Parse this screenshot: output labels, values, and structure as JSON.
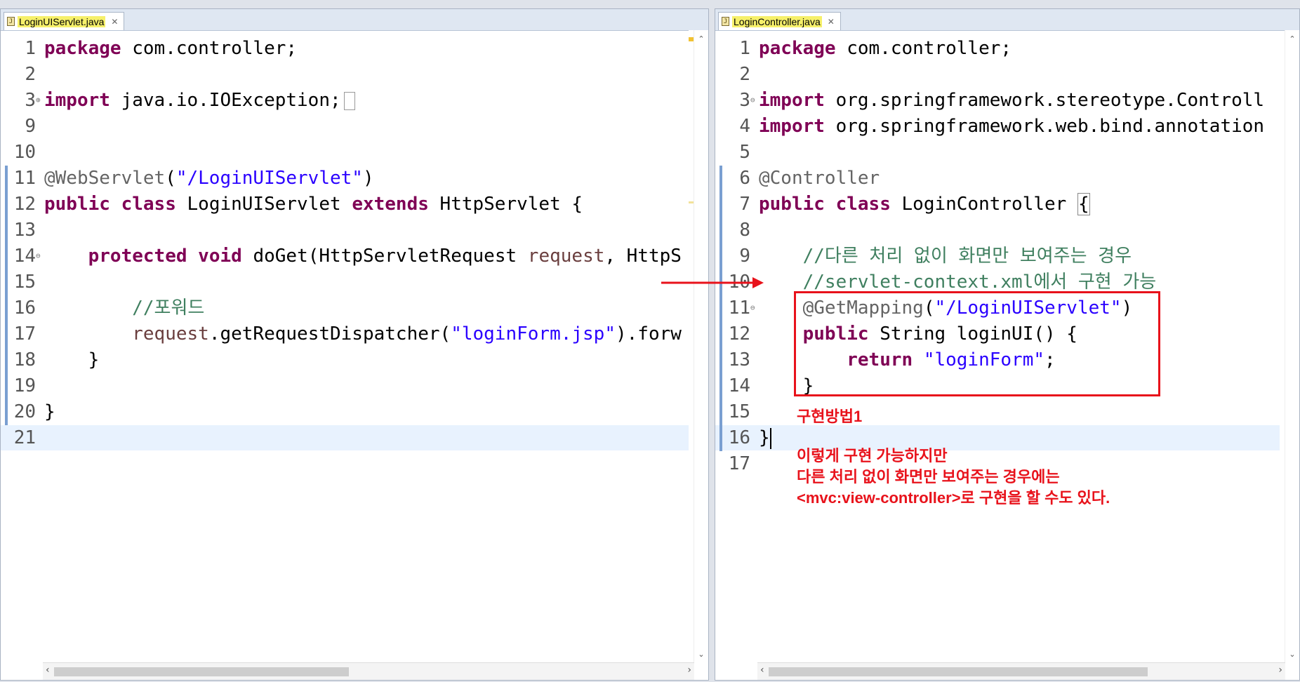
{
  "left_editor": {
    "tab_label": "LoginUIServlet.java",
    "lines": [
      {
        "n": "1",
        "segs": [
          {
            "t": "package",
            "c": "kw"
          },
          {
            "t": " com.controller;",
            "c": ""
          }
        ]
      },
      {
        "n": "2",
        "segs": []
      },
      {
        "n": "3",
        "segs": [
          {
            "t": "import",
            "c": "kw"
          },
          {
            "t": " java.io.IOException;",
            "c": ""
          }
        ],
        "fold": "⊕",
        "collapsed": true
      },
      {
        "n": "9",
        "segs": []
      },
      {
        "n": "10",
        "segs": []
      },
      {
        "n": "11",
        "segs": [
          {
            "t": "@WebServlet",
            "c": "ann"
          },
          {
            "t": "(",
            "c": ""
          },
          {
            "t": "\"/LoginUIServlet\"",
            "c": "str"
          },
          {
            "t": ")",
            "c": ""
          }
        ]
      },
      {
        "n": "12",
        "segs": [
          {
            "t": "public",
            "c": "kw"
          },
          {
            "t": " ",
            "c": ""
          },
          {
            "t": "class",
            "c": "kw"
          },
          {
            "t": " LoginUIServlet ",
            "c": ""
          },
          {
            "t": "extends",
            "c": "kw"
          },
          {
            "t": " HttpServlet {",
            "c": ""
          }
        ]
      },
      {
        "n": "13",
        "segs": []
      },
      {
        "n": "14",
        "segs": [
          {
            "t": "    ",
            "c": ""
          },
          {
            "t": "protected",
            "c": "kw"
          },
          {
            "t": " ",
            "c": ""
          },
          {
            "t": "void",
            "c": "kw"
          },
          {
            "t": " doGet(HttpServletRequest ",
            "c": ""
          },
          {
            "t": "request",
            "c": "param"
          },
          {
            "t": ", HttpS",
            "c": ""
          }
        ],
        "fold": "⊖"
      },
      {
        "n": "15",
        "segs": []
      },
      {
        "n": "16",
        "segs": [
          {
            "t": "        ",
            "c": ""
          },
          {
            "t": "//포워드",
            "c": "cmt"
          }
        ]
      },
      {
        "n": "17",
        "segs": [
          {
            "t": "        ",
            "c": ""
          },
          {
            "t": "request",
            "c": "param"
          },
          {
            "t": ".getRequestDispatcher(",
            "c": ""
          },
          {
            "t": "\"loginForm.jsp\"",
            "c": "str"
          },
          {
            "t": ").forw",
            "c": ""
          }
        ]
      },
      {
        "n": "18",
        "segs": [
          {
            "t": "    }",
            "c": ""
          }
        ]
      },
      {
        "n": "19",
        "segs": []
      },
      {
        "n": "20",
        "segs": [
          {
            "t": "}",
            "c": ""
          }
        ]
      },
      {
        "n": "21",
        "segs": [],
        "current": true
      }
    ]
  },
  "right_editor": {
    "tab_label": "LoginController.java",
    "lines": [
      {
        "n": "1",
        "segs": [
          {
            "t": "package",
            "c": "kw"
          },
          {
            "t": " com.controller;",
            "c": ""
          }
        ]
      },
      {
        "n": "2",
        "segs": []
      },
      {
        "n": "3",
        "segs": [
          {
            "t": "import",
            "c": "kw"
          },
          {
            "t": " org.springframework.stereotype.Controll",
            "c": ""
          }
        ],
        "fold": "⊖"
      },
      {
        "n": "4",
        "segs": [
          {
            "t": "import",
            "c": "kw"
          },
          {
            "t": " org.springframework.web.bind.annotation",
            "c": ""
          }
        ]
      },
      {
        "n": "5",
        "segs": []
      },
      {
        "n": "6",
        "segs": [
          {
            "t": "@Controller",
            "c": "ann"
          }
        ]
      },
      {
        "n": "7",
        "segs": [
          {
            "t": "public",
            "c": "kw"
          },
          {
            "t": " ",
            "c": ""
          },
          {
            "t": "class",
            "c": "kw"
          },
          {
            "t": " LoginController ",
            "c": ""
          },
          {
            "t": "{",
            "c": "bracket"
          }
        ]
      },
      {
        "n": "8",
        "segs": []
      },
      {
        "n": "9",
        "segs": [
          {
            "t": "    ",
            "c": ""
          },
          {
            "t": "//다른 처리 없이 화면만 보여주는 경우",
            "c": "cmt"
          }
        ]
      },
      {
        "n": "10",
        "segs": [
          {
            "t": "    ",
            "c": ""
          },
          {
            "t": "//servlet-context.xml에서 구현 가능",
            "c": "cmt"
          }
        ]
      },
      {
        "n": "11",
        "segs": [
          {
            "t": "    ",
            "c": ""
          },
          {
            "t": "@GetMapping",
            "c": "ann"
          },
          {
            "t": "(",
            "c": ""
          },
          {
            "t": "\"/LoginUIServlet\"",
            "c": "str"
          },
          {
            "t": ")",
            "c": ""
          }
        ],
        "fold": "⊖"
      },
      {
        "n": "12",
        "segs": [
          {
            "t": "    ",
            "c": ""
          },
          {
            "t": "public",
            "c": "kw"
          },
          {
            "t": " String loginUI() {",
            "c": ""
          }
        ]
      },
      {
        "n": "13",
        "segs": [
          {
            "t": "        ",
            "c": ""
          },
          {
            "t": "return",
            "c": "kw"
          },
          {
            "t": " ",
            "c": ""
          },
          {
            "t": "\"loginForm\"",
            "c": "str"
          },
          {
            "t": ";",
            "c": ""
          }
        ]
      },
      {
        "n": "14",
        "segs": [
          {
            "t": "    }",
            "c": ""
          }
        ]
      },
      {
        "n": "15",
        "segs": []
      },
      {
        "n": "16",
        "segs": [
          {
            "t": "}",
            "c": ""
          }
        ],
        "current": true,
        "caret": true
      },
      {
        "n": "17",
        "segs": []
      }
    ]
  },
  "annotations": {
    "method_label": "구현방법1",
    "note_lines": [
      "이렇게 구현 가능하지만",
      "다른 처리 없이 화면만 보여주는 경우에는",
      "<mvc:view-controller>로 구현을 할 수도 있다."
    ]
  },
  "colors": {
    "keyword": "#7f0055",
    "string": "#2a00ff",
    "comment": "#3f7f5f",
    "annotation_red": "#e8121b"
  }
}
